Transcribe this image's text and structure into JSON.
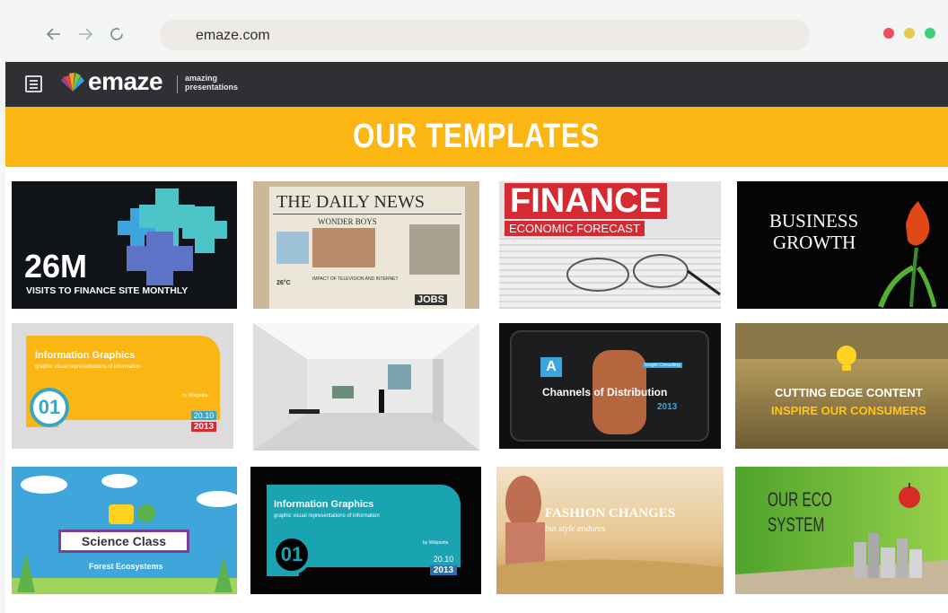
{
  "browser": {
    "back_icon": "arrow-left-icon",
    "forward_icon": "arrow-right-icon",
    "reload_icon": "reload-icon",
    "url": "emaze.com",
    "window_dots": [
      "#ee4f5e",
      "#e9c84f",
      "#3fcf7a"
    ]
  },
  "header": {
    "logo_text": "emaze",
    "tagline_line1": "amazing",
    "tagline_line2": "presentations"
  },
  "banner": {
    "title": "OUR TEMPLATES",
    "color": "#fcb613"
  },
  "templates": [
    {
      "big": "26M",
      "sub": "VISITS TO FINANCE SITE MONTHLY"
    },
    {
      "title": "THE DAILY NEWS",
      "headline": "WONDER BOYS",
      "caption": "IMPACT OF TELEVISION AND INTERNET",
      "temp": "26°C",
      "jobs": "JOBS"
    },
    {
      "title": "FINANCE",
      "sub": "ECONOMIC FORECAST"
    },
    {
      "line1": "BUSINESS",
      "line2": "GROWTH"
    },
    {
      "title": "Information Graphics",
      "sub": "graphic visual representations of information",
      "author": "by Wikipedia",
      "num": "01",
      "date1": "20.10",
      "date2": "2013"
    },
    {
      "name": "gallery-room"
    },
    {
      "letter": "A",
      "title": "Channels of Distribution",
      "year": "2013",
      "tag": "Insight Consulting"
    },
    {
      "line1": "CUTTING EDGE CONTENT",
      "line2": "INSPIRE OUR CONSUMERS"
    },
    {
      "title": "Science Class",
      "sub": "Forest Ecosystems"
    },
    {
      "title": "Information Graphics",
      "sub": "graphic visual representations of information",
      "author": "by Wikipedia",
      "num": "01",
      "date1": "20.10",
      "date2": "2013"
    },
    {
      "line1": "FASHION CHANGES",
      "line2": "but style endures"
    },
    {
      "line1": "OUR ECO",
      "line2": "SYSTEM"
    }
  ]
}
